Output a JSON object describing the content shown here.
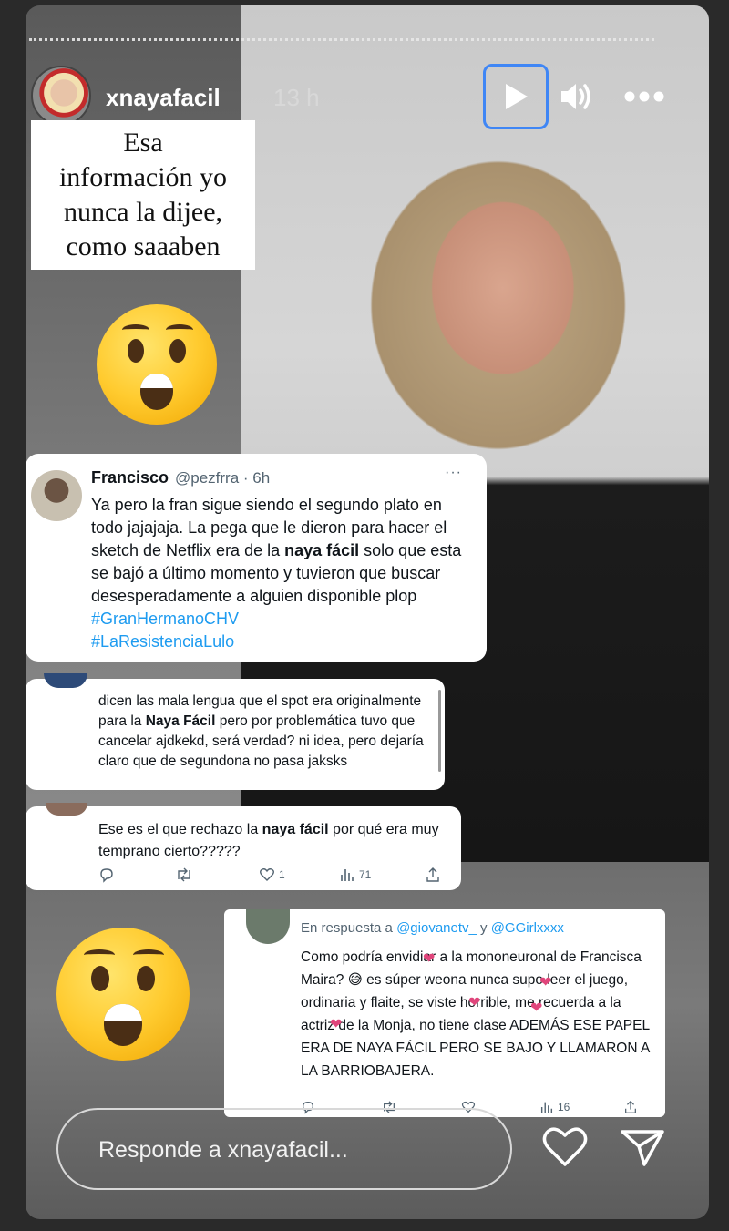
{
  "story": {
    "username": "xnayafacil",
    "time_ago": "13 h"
  },
  "caption": {
    "line1": "Esa",
    "line2": "información yo",
    "line3": "nunca la dijee,",
    "line4": "como saaaben"
  },
  "tweet1": {
    "name": "Francisco",
    "handle": "@pezfrra · 6h",
    "more": "···",
    "text_a": "Ya pero la fran sigue siendo el segundo plato en todo jajajaja. La pega que le dieron para hacer el sketch de Netflix era de la ",
    "bold": "naya fácil",
    "text_b": " solo que esta se bajó a último momento y tuvieron que buscar desesperadamente a alguien disponible plop ",
    "hashtag1": "#GranHermanoCHV",
    "hashtag2": "#LaResistenciaLulo"
  },
  "tweet2": {
    "text_a": "dicen las mala lengua que el spot era originalmente para la ",
    "bold": "Naya Fácil",
    "text_b": " pero por problemática tuvo que cancelar ajdkekd, será verdad? ni idea, pero dejaría claro que de segundona no pasa jaksks"
  },
  "tweet3": {
    "text_a": "Ese es el que rechazo la ",
    "bold": "naya fácil",
    "text_b": " por qué era muy temprano cierto?????",
    "likes": "1",
    "views": "71"
  },
  "tweet4": {
    "reply_prefix": "En respuesta a",
    "reply_to1": "@giovanetv_",
    "reply_and": "y",
    "reply_to2": "@GGirlxxxx",
    "text": "Como podría envidiar a la mononeuronal de Francisca Maira? 😅  es súper weona nunca supo leer el juego, ordinaria y flaite, se viste horrible, me recuerda a la actriz de la Monja, no tiene clase ADEMÁS ESE PAPEL ERA DE NAYA FÁCIL PERO SE BAJO Y LLAMARON A LA BARRIOBAJERA.",
    "views": "16"
  },
  "reply_bar": {
    "placeholder": "Responde a xnayafacil..."
  },
  "icons": {
    "play": "play-icon",
    "volume": "volume-icon",
    "more": "more-icon",
    "like": "heart-icon",
    "send": "send-icon"
  },
  "colors": {
    "focus_border": "#3f86f5",
    "hashtag": "#1d9bf0"
  }
}
